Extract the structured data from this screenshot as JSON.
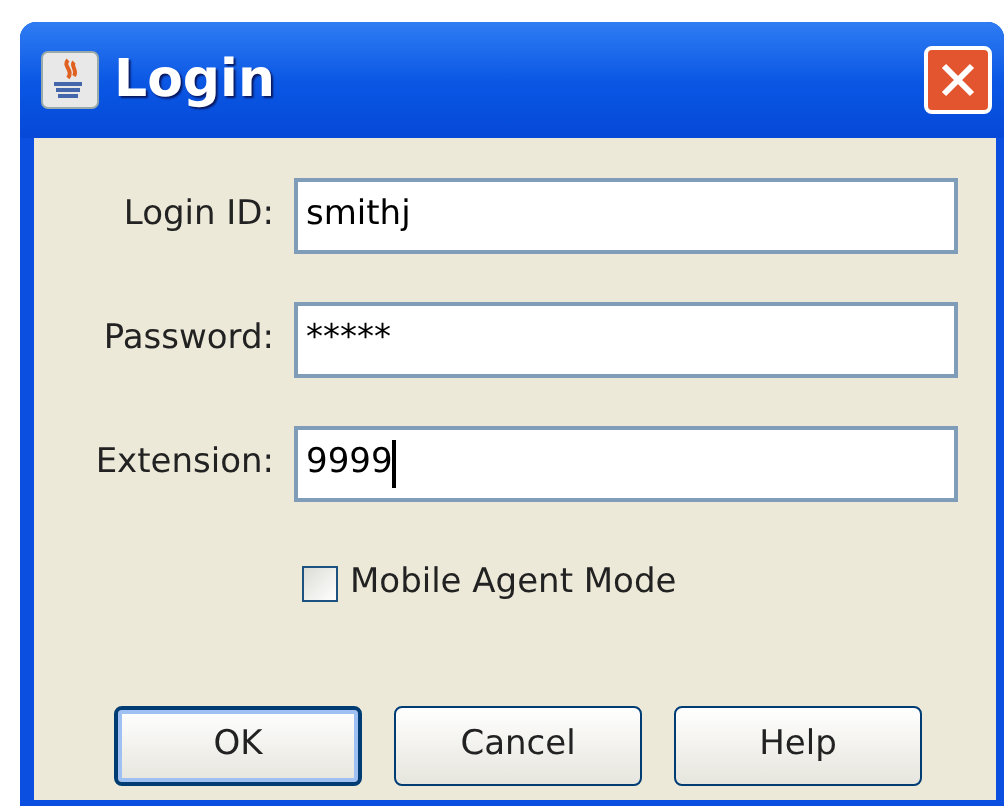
{
  "window": {
    "title": "Login"
  },
  "fields": [
    {
      "label": "Login ID:",
      "value": "smithj",
      "focused": false
    },
    {
      "label": "Password:",
      "value": "*****",
      "focused": false
    },
    {
      "label": "Extension:",
      "value": "9999",
      "focused": true
    }
  ],
  "checkbox": {
    "label": "Mobile Agent Mode",
    "checked": false
  },
  "buttons": [
    {
      "label": "OK",
      "default": true
    },
    {
      "label": "Cancel",
      "default": false
    },
    {
      "label": "Help",
      "default": false
    }
  ]
}
